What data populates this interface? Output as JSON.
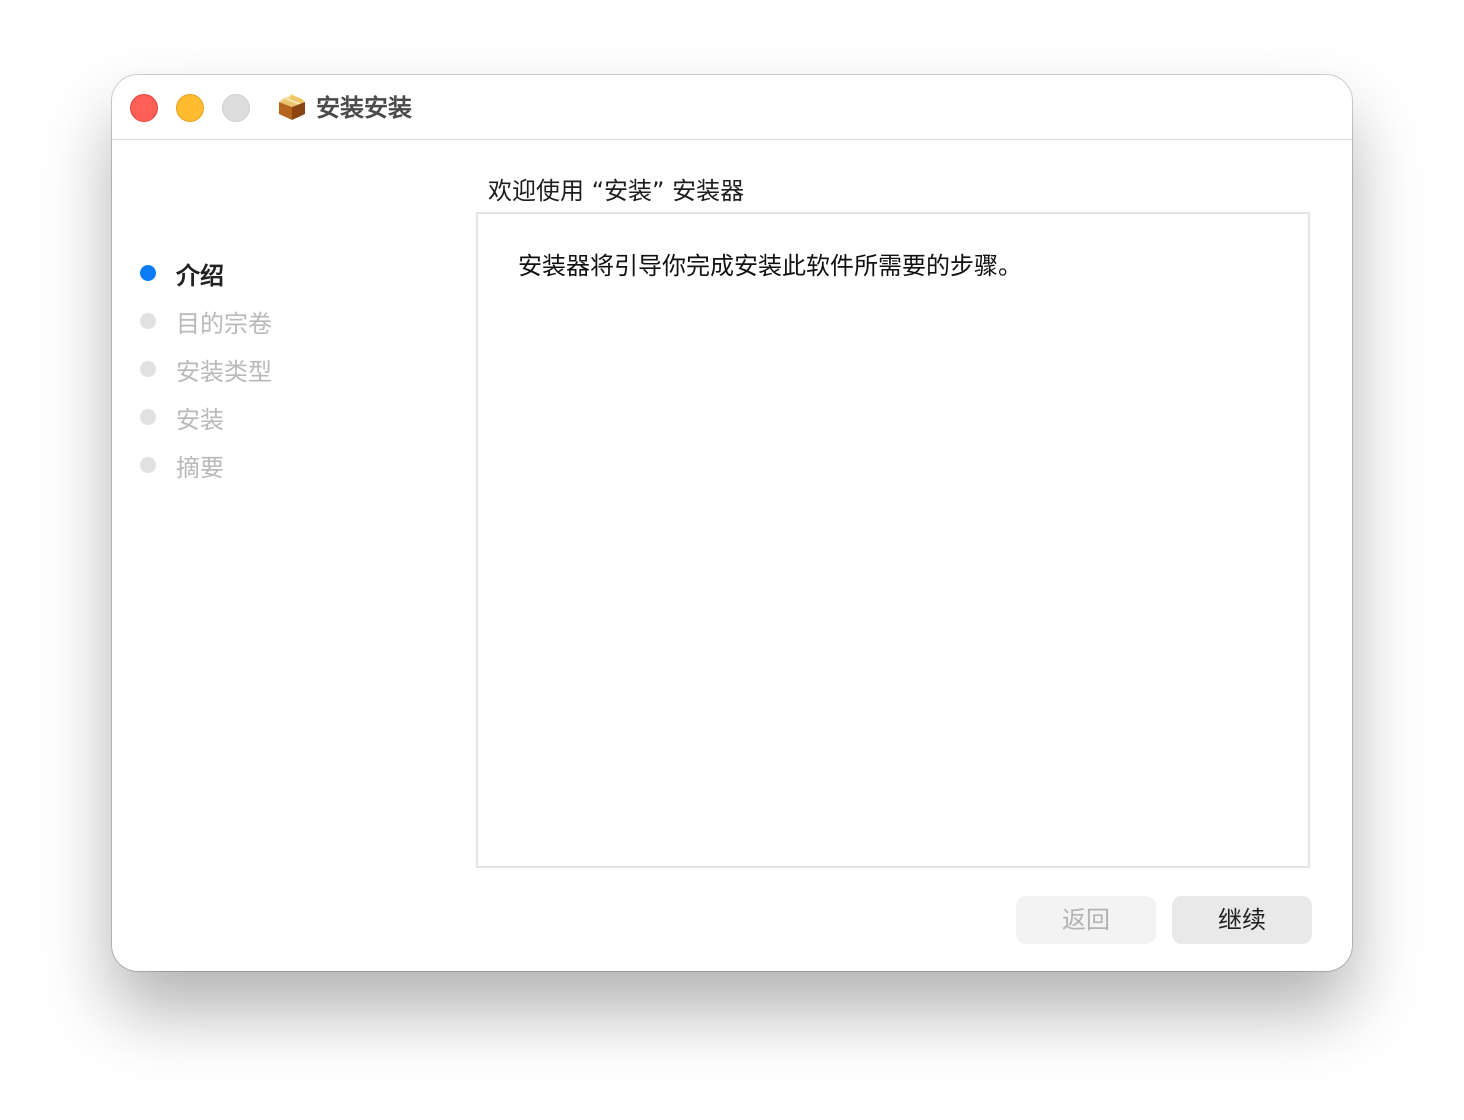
{
  "window": {
    "title": "安装安装",
    "app_icon": "package-installer-icon"
  },
  "traffic_lights": {
    "close_color": "#ff5f57",
    "minimize_color": "#febc2e",
    "zoom_color": "#dcdcdc"
  },
  "sidebar": {
    "steps": [
      {
        "label": "介绍",
        "active": true
      },
      {
        "label": "目的宗卷",
        "active": false
      },
      {
        "label": "安装类型",
        "active": false
      },
      {
        "label": "安装",
        "active": false
      },
      {
        "label": "摘要",
        "active": false
      }
    ],
    "active_color": "#0a7cf6",
    "inactive_color": "#e1e1e1"
  },
  "main": {
    "heading": "欢迎使用 “安装” 安装器",
    "body": "安装器将引导你完成安装此软件所需要的步骤。"
  },
  "buttons": {
    "back_label": "返回",
    "continue_label": "继续"
  }
}
